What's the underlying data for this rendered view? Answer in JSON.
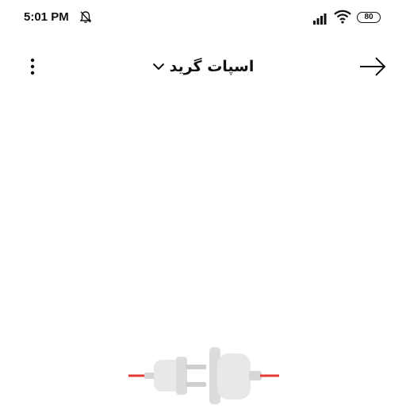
{
  "status_bar": {
    "time": "5:01 PM",
    "battery_level": "80",
    "icons": [
      "bell-off-icon",
      "signal-icon",
      "wifi-icon",
      "battery-icon"
    ]
  },
  "toolbar": {
    "title": "اسپات گرید",
    "icons": [
      "more-vert-icon",
      "chevron-down-icon",
      "arrow-right-icon"
    ]
  },
  "illustration": {
    "name": "disconnected-plug",
    "wire_color": "#e53935"
  },
  "colors": {
    "background": "#ffffff",
    "text": "#111111",
    "plug_body": "#e8e8e8"
  }
}
